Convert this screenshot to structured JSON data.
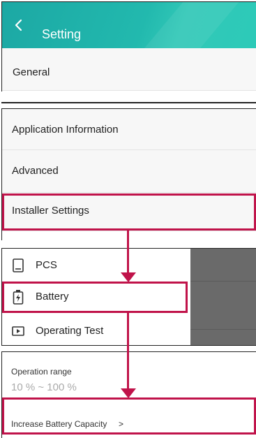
{
  "header": {
    "title": "Setting",
    "back_icon": "chevron-left-icon",
    "gradient_from": "#1ca8a4",
    "gradient_to": "#2ccab8"
  },
  "panel_general": {
    "item_label": "General"
  },
  "settings_list": {
    "items": [
      {
        "label": "Application Information"
      },
      {
        "label": "Advanced"
      },
      {
        "label": "Installer Settings"
      }
    ]
  },
  "installer_menu": {
    "items": [
      {
        "label": "PCS",
        "icon": "device-icon"
      },
      {
        "label": "Battery",
        "icon": "battery-icon"
      },
      {
        "label": "Operating Test",
        "icon": "play-icon"
      }
    ],
    "overlay_color": "#6a6a6a"
  },
  "battery_settings": {
    "operation_range_label": "Operation range",
    "operation_range_value": "10 % ~ 100 %",
    "increase_capacity_label": "Increase Battery Capacity",
    "increase_capacity_chevron": ">"
  },
  "annotations": {
    "highlight_color": "#c0134a"
  }
}
